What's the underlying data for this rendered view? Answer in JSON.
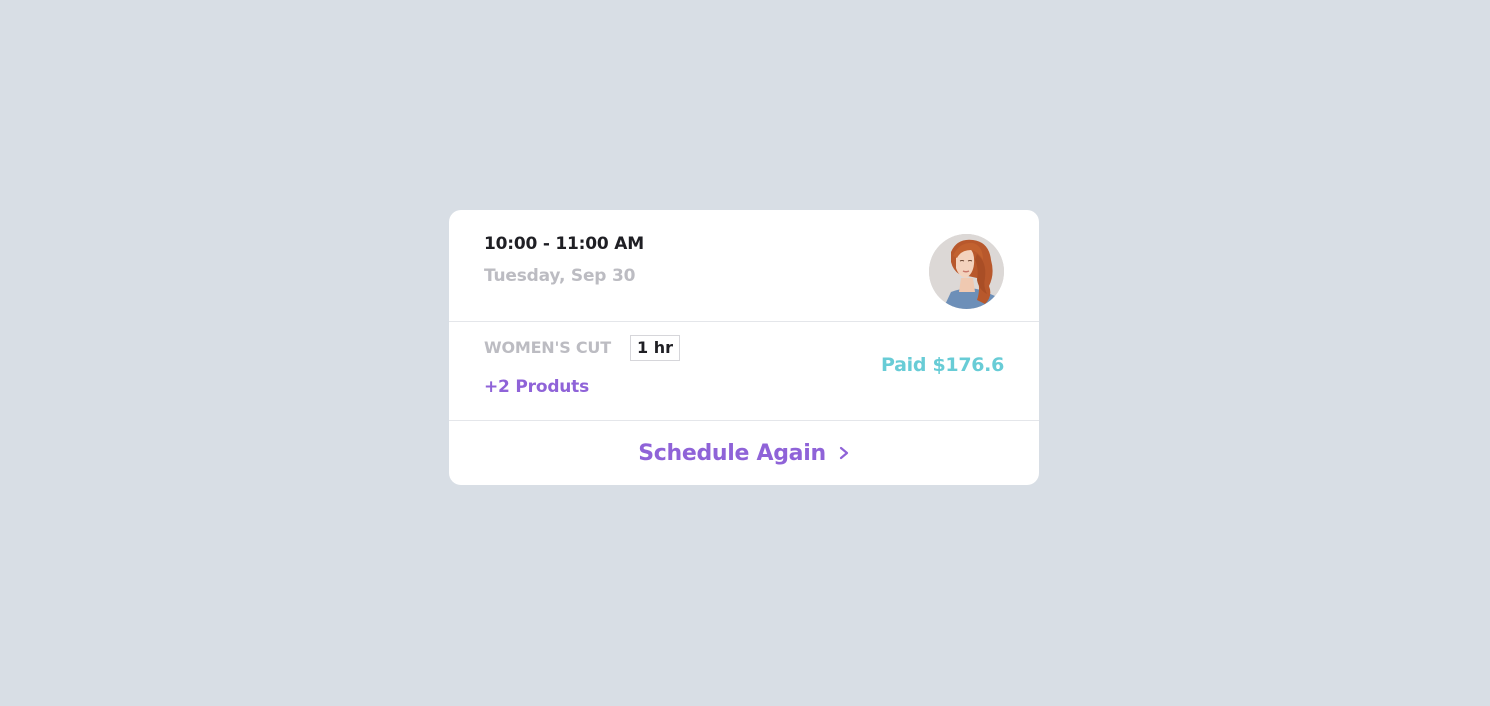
{
  "appointment": {
    "time_range": "10:00 - 11:00 AM",
    "date": "Tuesday, Sep 30"
  },
  "service": {
    "name": "WOMEN'S CUT",
    "duration": "1 hr",
    "products": "+2 Produts",
    "paid": "Paid $176.6"
  },
  "action": {
    "schedule_again": "Schedule Again",
    "icon": "chevron-right-icon"
  },
  "avatar": {
    "icon": "avatar-photo"
  },
  "colors": {
    "background": "#d8dee5",
    "card": "#ffffff",
    "primary_text": "#1f1f24",
    "muted_text": "#bcbcc2",
    "accent_purple": "#8f63d8",
    "accent_teal": "#68ccd6"
  }
}
